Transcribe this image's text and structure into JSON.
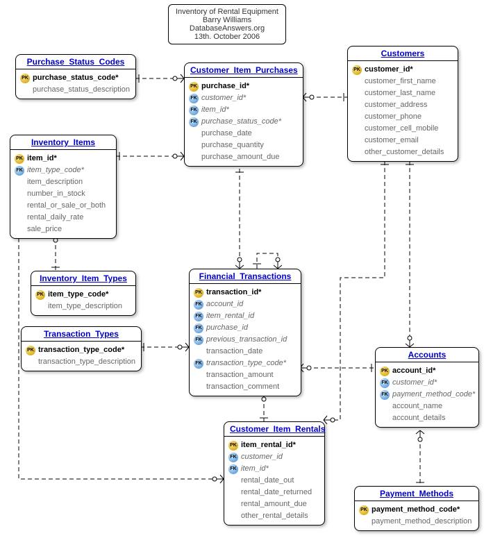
{
  "title_box": {
    "line1": "Inventory of Rental Equipment",
    "line2": "Barry Williams",
    "line3": "DatabaseAnswers.org",
    "line4": "13th. October 2006"
  },
  "entities": {
    "purchase_status_codes": {
      "title": "Purchase_Status_Codes",
      "attrs": [
        {
          "key": "pk",
          "name": "purchase_status_code*"
        },
        {
          "key": "",
          "name": "purchase_status_description"
        }
      ]
    },
    "customer_item_purchases": {
      "title": "Customer_Item_Purchases",
      "attrs": [
        {
          "key": "pk",
          "name": "purchase_id*"
        },
        {
          "key": "fk",
          "name": "customer_id*"
        },
        {
          "key": "fk",
          "name": "item_id*"
        },
        {
          "key": "fk",
          "name": "purchase_status_code*"
        },
        {
          "key": "",
          "name": "purchase_date"
        },
        {
          "key": "",
          "name": "purchase_quantity"
        },
        {
          "key": "",
          "name": "purchase_amount_due"
        }
      ]
    },
    "customers": {
      "title": "Customers",
      "attrs": [
        {
          "key": "pk",
          "name": "customer_id*"
        },
        {
          "key": "",
          "name": "customer_first_name"
        },
        {
          "key": "",
          "name": "customer_last_name"
        },
        {
          "key": "",
          "name": "customer_address"
        },
        {
          "key": "",
          "name": "customer_phone"
        },
        {
          "key": "",
          "name": "customer_cell_mobile"
        },
        {
          "key": "",
          "name": "customer_email"
        },
        {
          "key": "",
          "name": "other_customer_details"
        }
      ]
    },
    "inventory_items": {
      "title": "Inventory_Items",
      "attrs": [
        {
          "key": "pk",
          "name": "item_id*"
        },
        {
          "key": "fk",
          "name": "item_type_code*"
        },
        {
          "key": "",
          "name": "item_description"
        },
        {
          "key": "",
          "name": "number_in_stock"
        },
        {
          "key": "",
          "name": "rental_or_sale_or_both"
        },
        {
          "key": "",
          "name": "rental_daily_rate"
        },
        {
          "key": "",
          "name": "sale_price"
        }
      ]
    },
    "inventory_item_types": {
      "title": "Inventory_Item_Types",
      "attrs": [
        {
          "key": "pk",
          "name": "item_type_code*"
        },
        {
          "key": "",
          "name": "item_type_description"
        }
      ]
    },
    "transaction_types": {
      "title": "Transaction_Types",
      "attrs": [
        {
          "key": "pk",
          "name": "transaction_type_code*"
        },
        {
          "key": "",
          "name": "transaction_type_description"
        }
      ]
    },
    "financial_transactions": {
      "title": "Financial_Transactions",
      "attrs": [
        {
          "key": "pk",
          "name": "transaction_id*"
        },
        {
          "key": "fk",
          "name": "account_id"
        },
        {
          "key": "fk",
          "name": "item_rental_id"
        },
        {
          "key": "fk",
          "name": "purchase_id"
        },
        {
          "key": "fk",
          "name": "previous_transaction_id"
        },
        {
          "key": "",
          "name": "transaction_date"
        },
        {
          "key": "fk",
          "name": "transaction_type_code*"
        },
        {
          "key": "",
          "name": "transaction_amount"
        },
        {
          "key": "",
          "name": "transaction_comment"
        }
      ]
    },
    "accounts": {
      "title": "Accounts",
      "attrs": [
        {
          "key": "pk",
          "name": "account_id*"
        },
        {
          "key": "fk",
          "name": "customer_id*"
        },
        {
          "key": "fk",
          "name": "payment_method_code*"
        },
        {
          "key": "",
          "name": "account_name"
        },
        {
          "key": "",
          "name": "account_details"
        }
      ]
    },
    "customer_item_rentals": {
      "title": "Customer_Item_Rentals",
      "attrs": [
        {
          "key": "pk",
          "name": "item_rental_id*"
        },
        {
          "key": "fk",
          "name": "customer_id"
        },
        {
          "key": "fk",
          "name": "item_id*"
        },
        {
          "key": "",
          "name": "rental_date_out"
        },
        {
          "key": "",
          "name": "rental_date_returned"
        },
        {
          "key": "",
          "name": "rental_amount_due"
        },
        {
          "key": "",
          "name": "other_rental_details"
        }
      ]
    },
    "payment_methods": {
      "title": "Payment_Methods",
      "attrs": [
        {
          "key": "pk",
          "name": "payment_method_code*"
        },
        {
          "key": "",
          "name": "payment_method_description"
        }
      ]
    }
  },
  "chart_data": {
    "type": "entity-relationship-diagram",
    "title": "Inventory of Rental Equipment",
    "author": "Barry Williams",
    "source": "DatabaseAnswers.org",
    "date": "13th. October 2006",
    "entities": [
      "Purchase_Status_Codes",
      "Customer_Item_Purchases",
      "Customers",
      "Inventory_Items",
      "Inventory_Item_Types",
      "Transaction_Types",
      "Financial_Transactions",
      "Accounts",
      "Customer_Item_Rentals",
      "Payment_Methods"
    ],
    "relationships": [
      {
        "from": "Purchase_Status_Codes",
        "to": "Customer_Item_Purchases",
        "type": "one-to-many"
      },
      {
        "from": "Customers",
        "to": "Customer_Item_Purchases",
        "type": "one-to-many"
      },
      {
        "from": "Inventory_Items",
        "to": "Customer_Item_Purchases",
        "type": "one-to-many"
      },
      {
        "from": "Inventory_Item_Types",
        "to": "Inventory_Items",
        "type": "one-to-many"
      },
      {
        "from": "Customer_Item_Purchases",
        "to": "Financial_Transactions",
        "type": "one-to-many"
      },
      {
        "from": "Transaction_Types",
        "to": "Financial_Transactions",
        "type": "one-to-many"
      },
      {
        "from": "Financial_Transactions",
        "to": "Financial_Transactions",
        "type": "self-one-to-many"
      },
      {
        "from": "Accounts",
        "to": "Financial_Transactions",
        "type": "one-to-many"
      },
      {
        "from": "Customers",
        "to": "Accounts",
        "type": "one-to-many"
      },
      {
        "from": "Payment_Methods",
        "to": "Accounts",
        "type": "one-to-many"
      },
      {
        "from": "Customers",
        "to": "Customer_Item_Rentals",
        "type": "one-to-many"
      },
      {
        "from": "Customer_Item_Rentals",
        "to": "Financial_Transactions",
        "type": "one-to-many"
      },
      {
        "from": "Inventory_Items",
        "to": "Customer_Item_Rentals",
        "type": "one-to-many"
      }
    ]
  }
}
